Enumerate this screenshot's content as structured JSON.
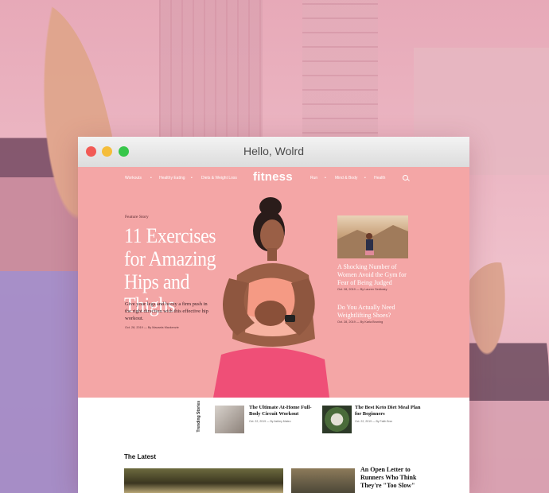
{
  "window": {
    "title": "Hello, Wolrd"
  },
  "nav": {
    "left": [
      "Workouts",
      "Healthy Eating",
      "Diets & Weight Loss"
    ],
    "logo": "fitness",
    "right": [
      "Run",
      "Mind & Body",
      "Health"
    ],
    "separator": "•"
  },
  "feature": {
    "label": "Feature Story",
    "title": "11 Exercises for Amazing Hips and Thighs",
    "dek": "Give your legs and booty a firm push in the right direction with this effective hip workout.",
    "byline": "Oct. 28, 2019 — By Macaela Mackenzie"
  },
  "side_stories": [
    {
      "title": "A Shocking Number of Women Avoid the Gym for Fear of Being Judged",
      "byline": "Oct. 28, 2019 — By Lauren Sedlosky"
    },
    {
      "title": "Do You Actually Need Weightlifting Shoes?",
      "byline": "Oct. 28, 2019 — By Karla Bruning"
    }
  ],
  "trending": {
    "label": "Trending Stories",
    "items": [
      {
        "title": "The Ultimate At-Home Full-Body Circuit Workout",
        "byline": "Oct. 22, 2019 — By Ashley Mateo"
      },
      {
        "title": "The Best Keto Diet Meal Plan for Beginners",
        "byline": "Oct. 22, 2019 — By Faith Brar"
      }
    ]
  },
  "latest": {
    "heading": "The Latest",
    "feature_title": "An Open Letter to Runners Who Think They're \"Too Slow\""
  },
  "colors": {
    "hero": "#f4a6a6",
    "accent": "#ffffff",
    "background": "#e9b3bf"
  }
}
